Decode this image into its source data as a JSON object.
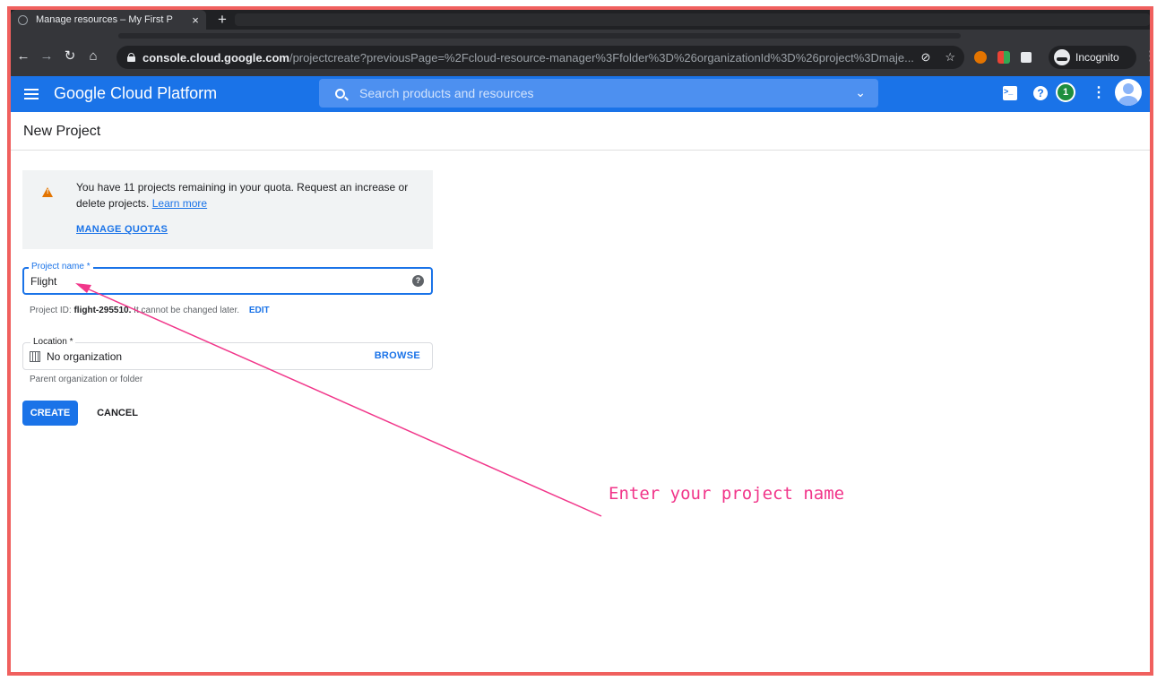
{
  "browser": {
    "tab_title": "Manage resources – My First P",
    "tab_close": "×",
    "new_tab": "+",
    "url_host": "console.cloud.google.com",
    "url_path": "/projectcreate?previousPage=%2Fcloud-resource-manager%3Ffolder%3D%26organizationId%3D%26project%3Dmaje...",
    "profile_label": "Incognito"
  },
  "header": {
    "brand": "Google Cloud Platform",
    "search_placeholder": "Search products and resources",
    "notification_count": "1"
  },
  "page": {
    "title": "New Project"
  },
  "quota": {
    "message": "You have 11 projects remaining in your quota. Request an increase or delete projects.",
    "learn_more": "Learn more",
    "manage_quotas": "MANAGE QUOTAS"
  },
  "form": {
    "project_name_label": "Project name *",
    "project_name_value": "Flight",
    "project_id_prefix": "Project ID:",
    "project_id_value": "flight-295510.",
    "project_id_suffix": "It cannot be changed later.",
    "edit_label": "EDIT",
    "location_label": "Location *",
    "location_value": "No organization",
    "browse_label": "BROWSE",
    "location_hint": "Parent organization or folder",
    "create_label": "CREATE",
    "cancel_label": "CANCEL"
  },
  "annotation": {
    "text": "Enter your project name",
    "color": "#f1368a"
  },
  "colors": {
    "gcp_blue": "#1a73e8",
    "warning": "#e37400",
    "frame_border": "#f0605e"
  }
}
